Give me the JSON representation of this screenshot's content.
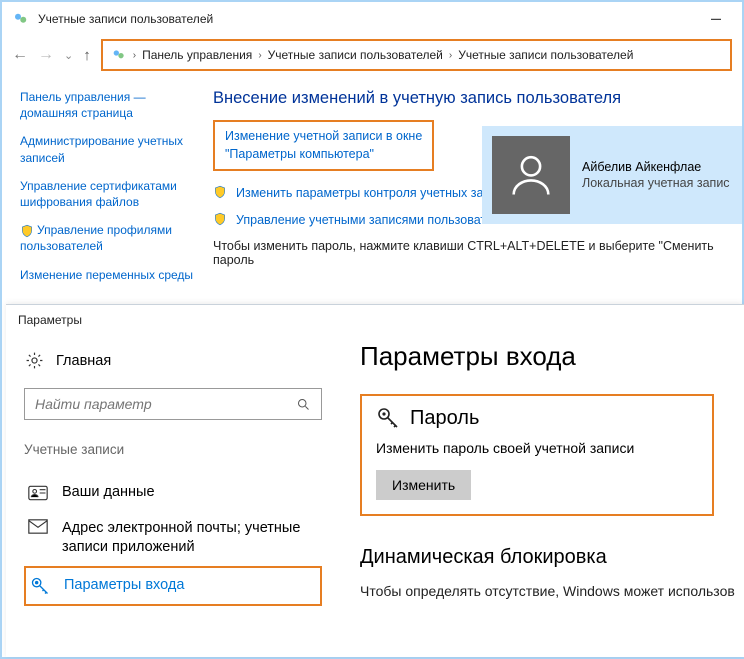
{
  "cp": {
    "title": "Учетные записи пользователей",
    "minimize": "–",
    "breadcrumb": [
      "Панель управления",
      "Учетные записи пользователей",
      "Учетные записи пользователей"
    ],
    "side_links": {
      "home": "Панель управления — домашняя страница",
      "admin": "Администрирование учетных записей",
      "certs": "Управление сертификатами шифрования файлов",
      "profiles": "Управление профилями пользователей",
      "env": "Изменение переменных среды"
    },
    "main_heading": "Внесение изменений в учетную запись пользователя",
    "box_link_line1": "Изменение учетной записи в окне",
    "box_link_line2": "\"Параметры компьютера\"",
    "link1": "Изменить параметры контроля учетных записей",
    "link2": "Управление учетными записями пользователей",
    "hint": "Чтобы изменить пароль, нажмите клавиши CTRL+ALT+DELETE и выберите \"Сменить пароль",
    "user_name": "Айбелив Айкенфлае",
    "user_type": "Локальная учетная запис"
  },
  "settings": {
    "title": "Параметры",
    "home": "Главная",
    "search_placeholder": "Найти параметр",
    "group": "Учетные записи",
    "nav": {
      "your_info": "Ваши данные",
      "email": "Адрес электронной почты; учетные записи приложений",
      "signin": "Параметры входа"
    },
    "main_heading": "Параметры входа",
    "pw_heading": "Пароль",
    "pw_desc": "Изменить пароль своей учетной записи",
    "pw_button": "Изменить",
    "dyn_heading": "Динамическая блокировка",
    "dyn_desc": "Чтобы определять отсутствие, Windows может использов"
  }
}
